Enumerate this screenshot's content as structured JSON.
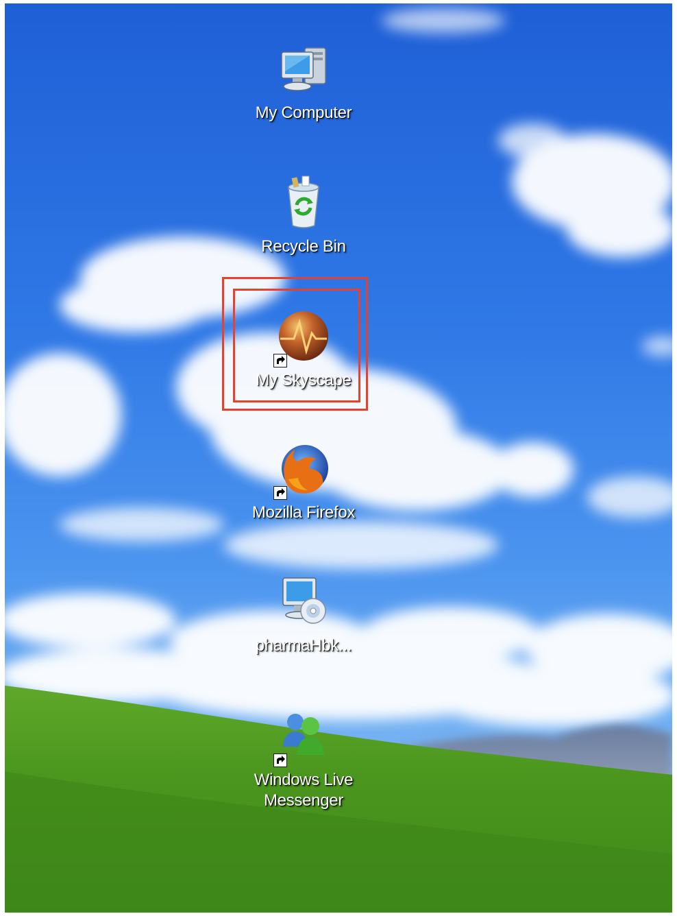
{
  "desktop": {
    "wallpaper": "bliss",
    "icons": [
      {
        "label": "My Computer",
        "icon": "computer-icon",
        "shortcut": false
      },
      {
        "label": "Recycle Bin",
        "icon": "recycle-bin-icon",
        "shortcut": false
      },
      {
        "label": "My Skyscape",
        "icon": "skyscape-icon",
        "shortcut": true,
        "highlighted": true
      },
      {
        "label": "Mozilla Firefox",
        "icon": "firefox-icon",
        "shortcut": true
      },
      {
        "label": "pharmaHbk...",
        "icon": "cd-install-icon",
        "shortcut": false
      },
      {
        "label": "Windows Live",
        "label_line2": "Messenger",
        "icon": "messenger-icon",
        "shortcut": true
      }
    ]
  },
  "colors": {
    "highlight": "#e8412b",
    "sky_top": "#1f5fd6",
    "grass": "#4f9a1f"
  }
}
